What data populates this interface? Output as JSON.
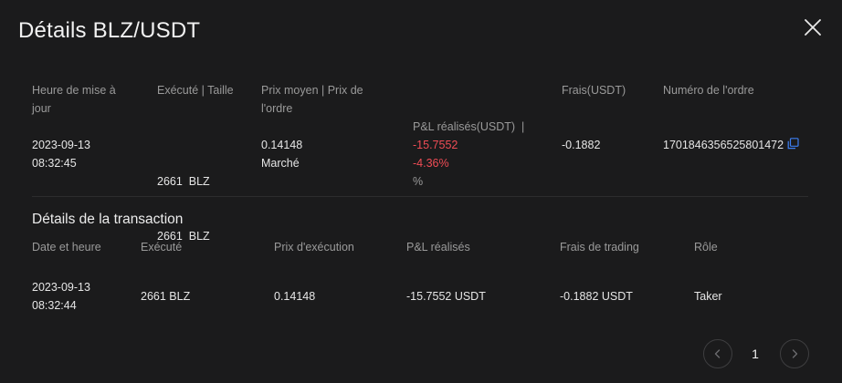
{
  "dialog": {
    "title": "Détails BLZ/USDT"
  },
  "order": {
    "headers": {
      "update_time_l1": "Heure de mise à",
      "update_time_l2": "jour",
      "executed_size": "Exécuté | Taille",
      "avg_price_l1": "Prix moyen | Prix de",
      "avg_price_l2": "l'ordre",
      "realized_pnl_l1": "P&L réalisés(USDT)  |",
      "realized_pnl_l2": "%",
      "fees": "Frais(USDT)",
      "order_number": "Numéro de l'ordre"
    },
    "row": {
      "date": "2023-09-13",
      "time": "08:32:45",
      "executed": "2661  BLZ",
      "size": "2661  BLZ",
      "avg_price": "0.14148",
      "order_price": "Marché",
      "pnl": "-15.7552",
      "pnl_pct": "-4.36%",
      "fees": "-0.1882",
      "order_id": "1701846356525801472"
    }
  },
  "transactions": {
    "title": "Détails de la transaction",
    "headers": {
      "datetime": "Date et heure",
      "executed": "Exécuté",
      "exec_price": "Prix d'exécution",
      "pnl": "P&L réalisés",
      "fees": "Frais de trading",
      "role": "Rôle"
    },
    "rows": [
      {
        "date": "2023-09-13",
        "time": "08:32:44",
        "executed": "2661 BLZ",
        "exec_price": "0.14148",
        "pnl": "-15.7552 USDT",
        "fees": "-0.1882 USDT",
        "role": "Taker"
      }
    ]
  },
  "pagination": {
    "current_page": "1"
  },
  "colors": {
    "background": "#1b1b1c",
    "negative": "#ef4c55",
    "accent": "#3d7ef0",
    "muted": "#9a9a9a"
  },
  "icons": {
    "close": "close-icon",
    "copy": "copy-icon",
    "prev": "chevron-left-icon",
    "next": "chevron-right-icon"
  }
}
